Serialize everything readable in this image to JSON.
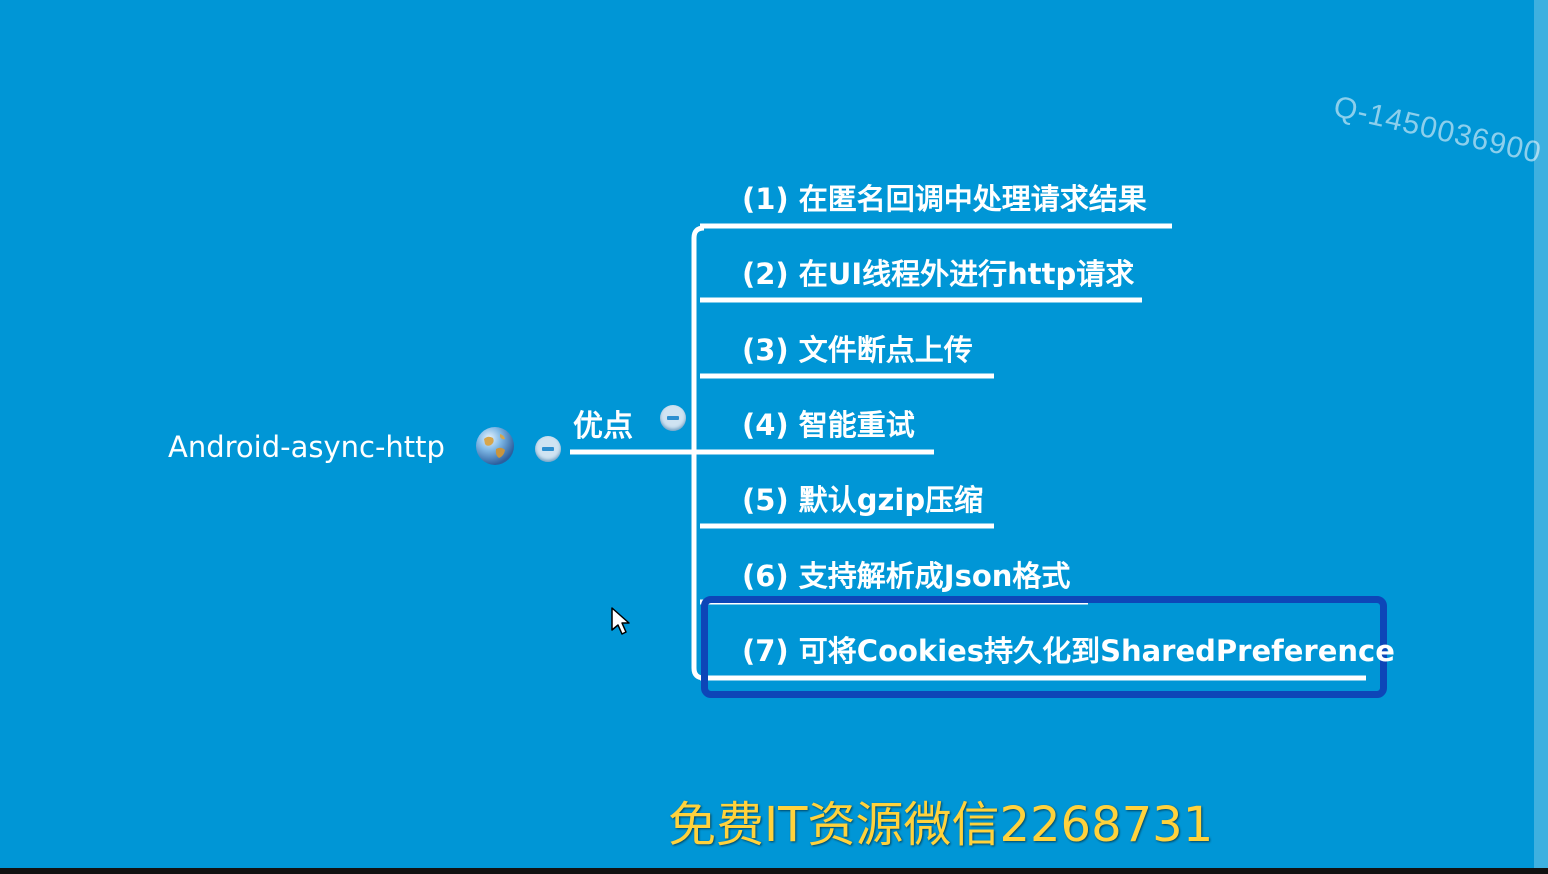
{
  "mindmap": {
    "root": {
      "label": "Android-async-http",
      "icon": "globe-icon"
    },
    "branch": {
      "label": "优点"
    },
    "items": [
      {
        "label": "(1) 在匿名回调中处理请求结果"
      },
      {
        "label": "(2) 在UI线程外进行http请求"
      },
      {
        "label": "(3) 文件断点上传"
      },
      {
        "label": "(4) 智能重试"
      },
      {
        "label": "(5) 默认gzip压缩"
      },
      {
        "label": "(6) 支持解析成Json格式"
      },
      {
        "label": "(7) 可将Cookies持久化到SharedPreference",
        "highlighted": true
      }
    ]
  },
  "overlay": {
    "watermark": "Q-1450036900",
    "footer": "免费IT资源微信2268731"
  },
  "colors": {
    "background": "#0096d6",
    "line": "#ffffff",
    "highlight_border": "#0d46b8",
    "footer_text": "#ffd23c"
  }
}
